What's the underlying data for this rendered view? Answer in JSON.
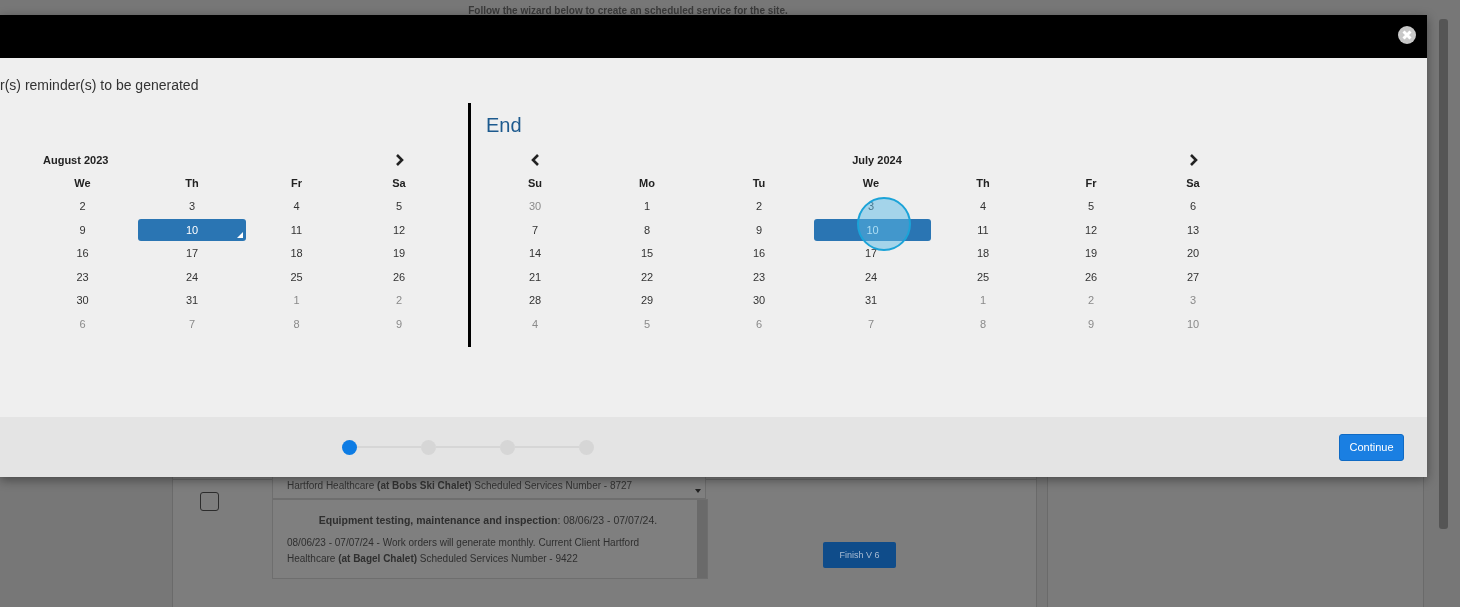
{
  "page": {
    "subtitle": "Follow the wizard below to create an scheduled service for the site."
  },
  "modal": {
    "intro": "r(s) reminder(s) to be generated",
    "start_calendar": {
      "month": "August 2023",
      "weekdays": [
        "We",
        "Th",
        "Fr",
        "Sa"
      ],
      "weeks": [
        [
          {
            "d": "2",
            "muted": false,
            "selected": false,
            "today": false
          },
          {
            "d": "3",
            "muted": false,
            "selected": false,
            "today": false
          },
          {
            "d": "4",
            "muted": false,
            "selected": false,
            "today": false
          },
          {
            "d": "5",
            "muted": false,
            "selected": false,
            "today": false
          }
        ],
        [
          {
            "d": "9",
            "muted": false,
            "selected": false,
            "today": false
          },
          {
            "d": "10",
            "muted": false,
            "selected": true,
            "today": true
          },
          {
            "d": "11",
            "muted": false,
            "selected": false,
            "today": false
          },
          {
            "d": "12",
            "muted": false,
            "selected": false,
            "today": false
          }
        ],
        [
          {
            "d": "16",
            "muted": false,
            "selected": false,
            "today": false
          },
          {
            "d": "17",
            "muted": false,
            "selected": false,
            "today": false
          },
          {
            "d": "18",
            "muted": false,
            "selected": false,
            "today": false
          },
          {
            "d": "19",
            "muted": false,
            "selected": false,
            "today": false
          }
        ],
        [
          {
            "d": "23",
            "muted": false,
            "selected": false,
            "today": false
          },
          {
            "d": "24",
            "muted": false,
            "selected": false,
            "today": false
          },
          {
            "d": "25",
            "muted": false,
            "selected": false,
            "today": false
          },
          {
            "d": "26",
            "muted": false,
            "selected": false,
            "today": false
          }
        ],
        [
          {
            "d": "30",
            "muted": false,
            "selected": false,
            "today": false
          },
          {
            "d": "31",
            "muted": false,
            "selected": false,
            "today": false
          },
          {
            "d": "1",
            "muted": true,
            "selected": false,
            "today": false
          },
          {
            "d": "2",
            "muted": true,
            "selected": false,
            "today": false
          }
        ],
        [
          {
            "d": "6",
            "muted": true,
            "selected": false,
            "today": false
          },
          {
            "d": "7",
            "muted": true,
            "selected": false,
            "today": false
          },
          {
            "d": "8",
            "muted": true,
            "selected": false,
            "today": false
          },
          {
            "d": "9",
            "muted": true,
            "selected": false,
            "today": false
          }
        ]
      ]
    },
    "end_calendar": {
      "heading": "End",
      "month": "July 2024",
      "weekdays": [
        "Su",
        "Mo",
        "Tu",
        "We",
        "Th",
        "Fr",
        "Sa"
      ],
      "weeks": [
        [
          {
            "d": "30",
            "muted": true,
            "selected": false,
            "today": false
          },
          {
            "d": "1",
            "muted": false,
            "selected": false,
            "today": false
          },
          {
            "d": "2",
            "muted": false,
            "selected": false,
            "today": false
          },
          {
            "d": "3",
            "muted": false,
            "selected": false,
            "today": false
          },
          {
            "d": "4",
            "muted": false,
            "selected": false,
            "today": false
          },
          {
            "d": "5",
            "muted": false,
            "selected": false,
            "today": false
          },
          {
            "d": "6",
            "muted": false,
            "selected": false,
            "today": false
          }
        ],
        [
          {
            "d": "7",
            "muted": false,
            "selected": false,
            "today": false
          },
          {
            "d": "8",
            "muted": false,
            "selected": false,
            "today": false
          },
          {
            "d": "9",
            "muted": false,
            "selected": false,
            "today": false
          },
          {
            "d": "10",
            "muted": false,
            "selected": true,
            "today": false
          },
          {
            "d": "11",
            "muted": false,
            "selected": false,
            "today": false
          },
          {
            "d": "12",
            "muted": false,
            "selected": false,
            "today": false
          },
          {
            "d": "13",
            "muted": false,
            "selected": false,
            "today": false
          }
        ],
        [
          {
            "d": "14",
            "muted": false,
            "selected": false,
            "today": false
          },
          {
            "d": "15",
            "muted": false,
            "selected": false,
            "today": false
          },
          {
            "d": "16",
            "muted": false,
            "selected": false,
            "today": false
          },
          {
            "d": "17",
            "muted": false,
            "selected": false,
            "today": false
          },
          {
            "d": "18",
            "muted": false,
            "selected": false,
            "today": false
          },
          {
            "d": "19",
            "muted": false,
            "selected": false,
            "today": false
          },
          {
            "d": "20",
            "muted": false,
            "selected": false,
            "today": false
          }
        ],
        [
          {
            "d": "21",
            "muted": false,
            "selected": false,
            "today": false
          },
          {
            "d": "22",
            "muted": false,
            "selected": false,
            "today": false
          },
          {
            "d": "23",
            "muted": false,
            "selected": false,
            "today": false
          },
          {
            "d": "24",
            "muted": false,
            "selected": false,
            "today": false
          },
          {
            "d": "25",
            "muted": false,
            "selected": false,
            "today": false
          },
          {
            "d": "26",
            "muted": false,
            "selected": false,
            "today": false
          },
          {
            "d": "27",
            "muted": false,
            "selected": false,
            "today": false
          }
        ],
        [
          {
            "d": "28",
            "muted": false,
            "selected": false,
            "today": false
          },
          {
            "d": "29",
            "muted": false,
            "selected": false,
            "today": false
          },
          {
            "d": "30",
            "muted": false,
            "selected": false,
            "today": false
          },
          {
            "d": "31",
            "muted": false,
            "selected": false,
            "today": false
          },
          {
            "d": "1",
            "muted": true,
            "selected": false,
            "today": false
          },
          {
            "d": "2",
            "muted": true,
            "selected": false,
            "today": false
          },
          {
            "d": "3",
            "muted": true,
            "selected": false,
            "today": false
          }
        ],
        [
          {
            "d": "4",
            "muted": true,
            "selected": false,
            "today": false
          },
          {
            "d": "5",
            "muted": true,
            "selected": false,
            "today": false
          },
          {
            "d": "6",
            "muted": true,
            "selected": false,
            "today": false
          },
          {
            "d": "7",
            "muted": true,
            "selected": false,
            "today": false
          },
          {
            "d": "8",
            "muted": true,
            "selected": false,
            "today": false
          },
          {
            "d": "9",
            "muted": true,
            "selected": false,
            "today": false
          },
          {
            "d": "10",
            "muted": true,
            "selected": false,
            "today": false
          }
        ]
      ]
    },
    "steps": [
      {
        "selected": true
      },
      {
        "selected": false
      },
      {
        "selected": false
      },
      {
        "selected": false
      }
    ],
    "continue": "Continue"
  },
  "services": [
    {
      "summary": "Hartford Healthcare **(at Bobs Ski Chalet)** Scheduled Services Number - 8727"
    },
    {
      "checked": false,
      "title": "Equipment testing, maintenance and inspection",
      "dates": ": 08/06/23 - 07/07/24.",
      "description": "08/06/23 - 07/07/24 - Work orders will generate monthly. Current Client Hartford Healthcare **(at Bagel Chalet)** Scheduled Services Number - 9422",
      "action": "Finish V 6"
    }
  ]
}
